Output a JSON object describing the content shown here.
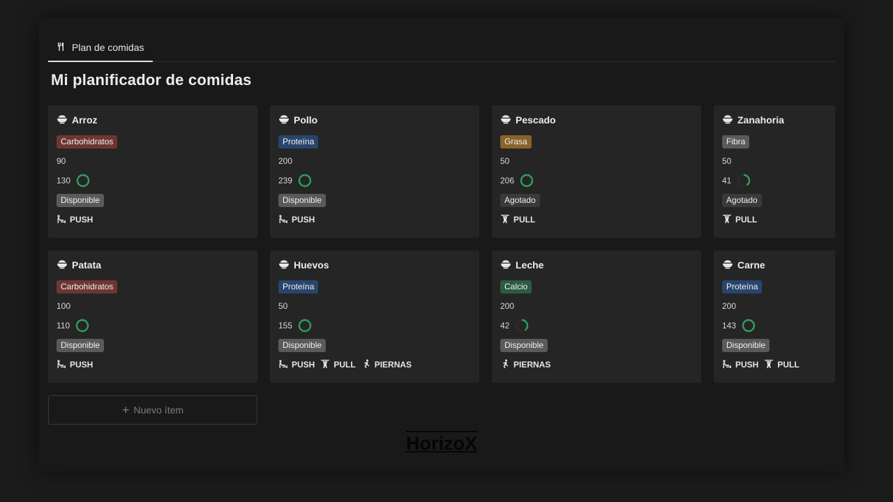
{
  "tab": {
    "label": "Plan de comidas",
    "icon": "fork-knife-icon"
  },
  "page": {
    "title": "Mi planificador de comidas"
  },
  "cards": [
    {
      "name": "Arroz",
      "category": "Carbohidratos",
      "category_color": "#6e3630",
      "amount": "90",
      "calories": "130",
      "progress": 1.0,
      "status": "Disponible",
      "routines": [
        "PUSH"
      ]
    },
    {
      "name": "Pollo",
      "category": "Proteína",
      "category_color": "#28456c",
      "amount": "200",
      "calories": "239",
      "progress": 1.0,
      "status": "Disponible",
      "routines": [
        "PUSH"
      ]
    },
    {
      "name": "Pescado",
      "category": "Grasa",
      "category_color": "#89632a",
      "amount": "50",
      "calories": "206",
      "progress": 1.0,
      "status": "Agotado",
      "routines": [
        "PULL"
      ]
    },
    {
      "name": "Zanahoria",
      "category": "Fibra",
      "category_color": "#5a5a5a",
      "amount": "50",
      "calories": "41",
      "progress": 0.4,
      "status": "Agotado",
      "routines": [
        "PULL"
      ]
    },
    {
      "name": "Patata",
      "category": "Carbohidratos",
      "category_color": "#6e3630",
      "amount": "100",
      "calories": "110",
      "progress": 1.0,
      "status": "Disponible",
      "routines": [
        "PUSH"
      ]
    },
    {
      "name": "Huevos",
      "category": "Proteína",
      "category_color": "#28456c",
      "amount": "50",
      "calories": "155",
      "progress": 1.0,
      "status": "Disponible",
      "routines": [
        "PUSH",
        "PULL",
        "PIERNAS"
      ]
    },
    {
      "name": "Leche",
      "category": "Calcio",
      "category_color": "#2b5b41",
      "amount": "200",
      "calories": "42",
      "progress": 0.4,
      "status": "Disponible",
      "routines": [
        "PIERNAS"
      ]
    },
    {
      "name": "Carne",
      "category": "Proteína",
      "category_color": "#28456c",
      "amount": "200",
      "calories": "143",
      "progress": 1.0,
      "status": "Disponible",
      "routines": [
        "PUSH",
        "PULL"
      ]
    }
  ],
  "new_item": {
    "label": "Nuevo ítem"
  },
  "watermark": "HorizoX",
  "colors": {
    "progress_ring": "#2f9e5e",
    "background": "#191919",
    "card": "#252525"
  }
}
